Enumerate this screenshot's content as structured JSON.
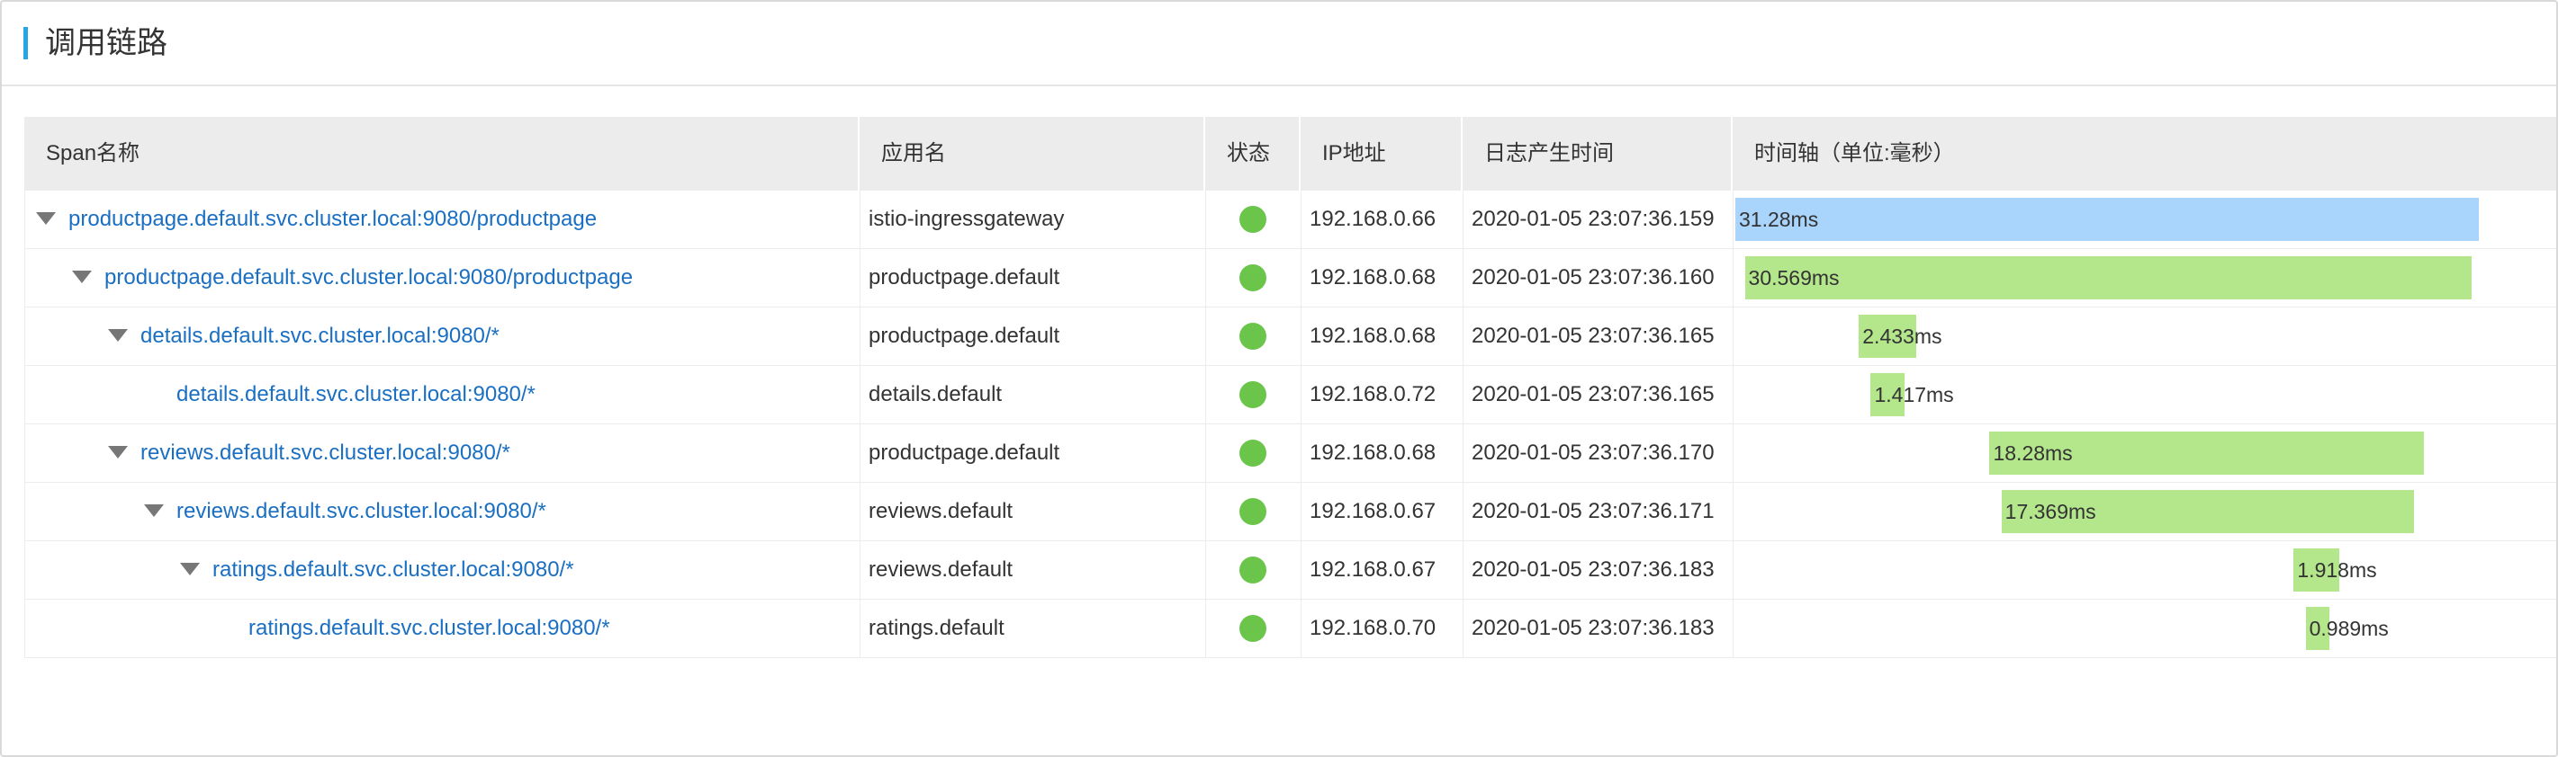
{
  "page": {
    "title": "调用链路"
  },
  "columns": {
    "span_name": "Span名称",
    "app_name": "应用名",
    "status": "状态",
    "ip": "IP地址",
    "log_time": "日志产生时间",
    "timeline": "时间轴（单位:毫秒）"
  },
  "colors": {
    "accent": "#26a7e3",
    "link": "#1a6fc2",
    "status_ok": "#6bc54b",
    "root_bar": "#a9d4fb",
    "child_bar": "#b4e68b",
    "header_bg": "#ececec"
  },
  "rows": [
    {
      "span": "productpage.default.svc.cluster.local:9080/productpage",
      "app": "istio-ingressgateway",
      "status": "ok",
      "ip": "192.168.0.66",
      "time": "2020-01-05 23:07:36.159",
      "duration": "31.28ms",
      "depth": 0,
      "expandable": true,
      "start_ms": 0,
      "duration_ms": 31.28
    },
    {
      "span": "productpage.default.svc.cluster.local:9080/productpage",
      "app": "productpage.default",
      "status": "ok",
      "ip": "192.168.0.68",
      "time": "2020-01-05 23:07:36.160",
      "duration": "30.569ms",
      "depth": 1,
      "expandable": true,
      "start_ms": 0.4,
      "duration_ms": 30.569
    },
    {
      "span": "details.default.svc.cluster.local:9080/*",
      "app": "productpage.default",
      "status": "ok",
      "ip": "192.168.0.68",
      "time": "2020-01-05 23:07:36.165",
      "duration": "2.433ms",
      "depth": 2,
      "expandable": true,
      "start_ms": 5.2,
      "duration_ms": 2.433
    },
    {
      "span": "details.default.svc.cluster.local:9080/*",
      "app": "details.default",
      "status": "ok",
      "ip": "192.168.0.72",
      "time": "2020-01-05 23:07:36.165",
      "duration": "1.417ms",
      "depth": 3,
      "expandable": false,
      "start_ms": 5.7,
      "duration_ms": 1.417
    },
    {
      "span": "reviews.default.svc.cluster.local:9080/*",
      "app": "productpage.default",
      "status": "ok",
      "ip": "192.168.0.68",
      "time": "2020-01-05 23:07:36.170",
      "duration": "18.28ms",
      "depth": 2,
      "expandable": true,
      "start_ms": 10.7,
      "duration_ms": 18.28
    },
    {
      "span": "reviews.default.svc.cluster.local:9080/*",
      "app": "reviews.default",
      "status": "ok",
      "ip": "192.168.0.67",
      "time": "2020-01-05 23:07:36.171",
      "duration": "17.369ms",
      "depth": 3,
      "expandable": true,
      "start_ms": 11.2,
      "duration_ms": 17.369
    },
    {
      "span": "ratings.default.svc.cluster.local:9080/*",
      "app": "reviews.default",
      "status": "ok",
      "ip": "192.168.0.67",
      "time": "2020-01-05 23:07:36.183",
      "duration": "1.918ms",
      "depth": 4,
      "expandable": true,
      "start_ms": 23.5,
      "duration_ms": 1.918
    },
    {
      "span": "ratings.default.svc.cluster.local:9080/*",
      "app": "ratings.default",
      "status": "ok",
      "ip": "192.168.0.70",
      "time": "2020-01-05 23:07:36.183",
      "duration": "0.989ms",
      "depth": 5,
      "expandable": false,
      "start_ms": 24.0,
      "duration_ms": 0.989
    }
  ]
}
